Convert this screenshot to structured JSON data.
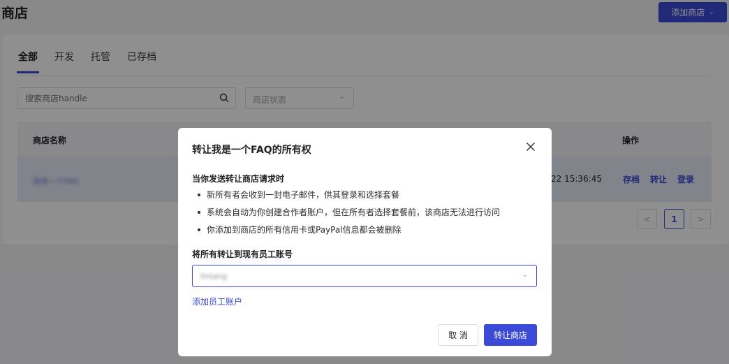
{
  "page": {
    "title": "商店"
  },
  "header": {
    "add_store_label": "添加商店",
    "chevron_icon": "chevron-down-icon"
  },
  "tabs": [
    {
      "label": "全部",
      "active": true
    },
    {
      "label": "开发",
      "active": false
    },
    {
      "label": "托管",
      "active": false
    },
    {
      "label": "已存档",
      "active": false
    }
  ],
  "filters": {
    "search_placeholder": "搜索商店handle",
    "search_icon": "search-icon",
    "status_placeholder": "商店状态"
  },
  "table": {
    "columns": {
      "store_name": "商店名称",
      "actions": "操作"
    },
    "rows": [
      {
        "store_name": "我是一个FAQ",
        "date": "22 15:36:45",
        "actions": [
          "存档",
          "转让",
          "登录"
        ]
      }
    ]
  },
  "pagination": {
    "current_page": "1",
    "prev": "<",
    "next": ">"
  },
  "modal": {
    "title": "转让我是一个FAQ的所有权",
    "close_icon": "close-icon",
    "section_title": "当你发送转让商店请求时",
    "bullets": [
      "新所有者会收到一封电子邮件，供其登录和选择套餐",
      "系统会自动为你创建合作者账户，但在所有者选择套餐前，该商店无法进行访问",
      "你添加到商店的所有信用卡或PayPal信息都会被删除"
    ],
    "account_label": "将所有转让到现有员工账号",
    "account_value": "lintang",
    "add_staff_label": "添加员工账户",
    "cancel_label": "取 消",
    "confirm_label": "转让商店"
  },
  "colors": {
    "primary": "#3b4bd8",
    "overlay": "rgba(0,0,0,0.44)"
  }
}
